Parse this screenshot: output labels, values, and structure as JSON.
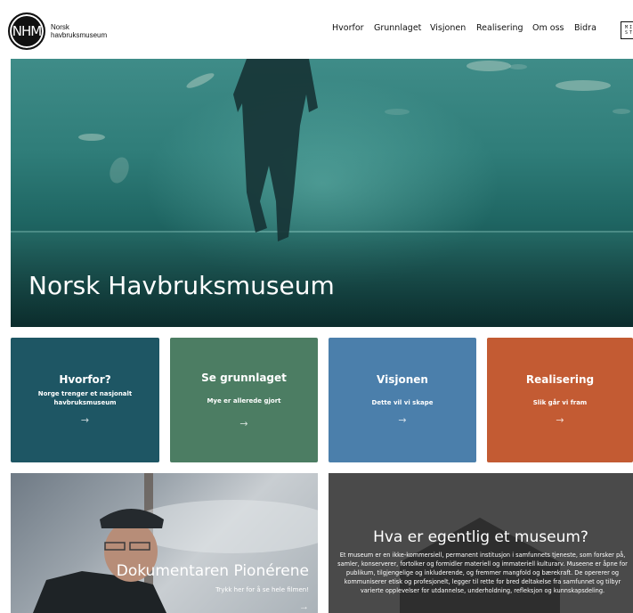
{
  "header": {
    "logo_mark": "NHM",
    "logo_line1": "Norsk",
    "logo_line2": "havbruksmuseum",
    "nav": [
      "Hvorfor",
      "Grunnlaget",
      "Visjonen",
      "Realisering",
      "Om oss",
      "Bidra"
    ],
    "mini_box_text": "MI ST"
  },
  "hero": {
    "title": "Norsk Havbruksmuseum"
  },
  "cards": [
    {
      "title": "Hvorfor?",
      "subtitle": "Norge trenger et nasjonalt havbruksmuseum",
      "arrow": "→",
      "color": "#1e5664"
    },
    {
      "title": "Se grunnlaget",
      "subtitle": "Mye er allerede gjort",
      "arrow": "→",
      "color": "#4c7d63"
    },
    {
      "title": "Visjonen",
      "subtitle": "Dette vil vi skape",
      "arrow": "→",
      "color": "#4b7fab"
    },
    {
      "title": "Realisering",
      "subtitle": "Slik går vi fram",
      "arrow": "→",
      "color": "#c35b33"
    }
  ],
  "documentary": {
    "title": "Dokumentaren Pionérene",
    "subtitle": "Trykk her for å se hele filmen!",
    "arrow": "→"
  },
  "museum": {
    "title": "Hva er egentlig et museum?",
    "body": "Et museum er en ikke-kommersiell, permanent institusjon i samfunnets tjeneste, som forsker på, samler, konserverer, fortolker og formidler materiell og immateriell kulturarv. Museene er åpne for publikum, tilgjengelige og inkluderende, og fremmer mangfold og bærekraft. De opererer og kommuniserer etisk og profesjonelt, legger til rette for bred deltakelse fra samfunnet og tilbyr varierte opplevelser for utdannelse, underholdning, refleksjon og kunnskapsdeling."
  }
}
